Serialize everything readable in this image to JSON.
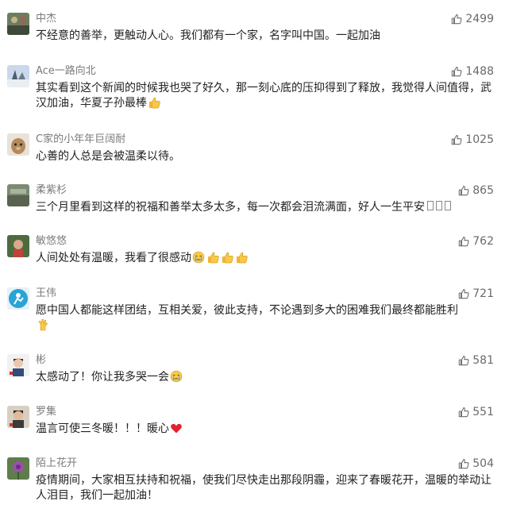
{
  "comments": [
    {
      "name": "中杰",
      "likes": "2499",
      "text": "不经意的善举，更触动人心。我们都有一个家，名字叫中国。一起加油"
    },
    {
      "name": "Ace一路向北",
      "likes": "1488",
      "text": "其实看到这个新闻的时候我也哭了好久，那一刻心底的压抑得到了释放，我觉得人间值得，武汉加油，华夏子孙最棒"
    },
    {
      "name": "C家的小年年巨阔耐",
      "likes": "1025",
      "text": "心善的人总是会被温柔以待。"
    },
    {
      "name": "柔紫杉",
      "likes": "865",
      "text": "三个月里看到这样的祝福和善举太多太多，每一次都会泪流满面，好人一生平安"
    },
    {
      "name": "敏悠悠",
      "likes": "762",
      "text": "人间处处有温暖，我看了很感动"
    },
    {
      "name": "王伟",
      "likes": "721",
      "text": "愿中国人都能这样团结，互相关爱，彼此支持，不论遇到多大的困难我们最终都能胜利"
    },
    {
      "name": "彬",
      "likes": "581",
      "text": "太感动了！你让我多哭一会"
    },
    {
      "name": "罗集",
      "likes": "551",
      "text": "温言可使三冬暖！！！暖心"
    },
    {
      "name": "陌上花开",
      "likes": "504",
      "text": "疫情期间，大家相互扶持和祝福，使我们尽快走出那段阴霾，迎来了春暖花开，温暖的举动让人泪目，我们一起加油！"
    }
  ],
  "icons": {
    "like": "thumbs-up-icon",
    "emoji_like": "thumbs-up-emoji",
    "emoji_cry": "crying-emoji",
    "emoji_ok": "ok-hand-emoji",
    "emoji_heart": "red-heart-emoji"
  },
  "colors": {
    "name": "#7b7b7b",
    "text": "#222222",
    "likes": "#6a6a6a",
    "background": "#ffffff"
  }
}
